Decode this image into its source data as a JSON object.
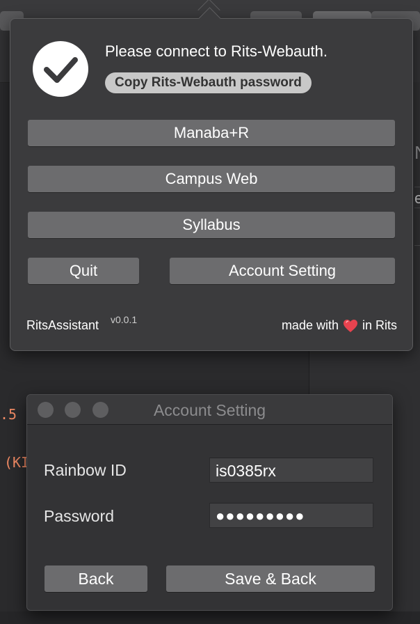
{
  "background": {
    "side_text_1": "N",
    "side_text_2": "e",
    "code_line_1": ".5",
    "code_line_2": "(KI"
  },
  "popover": {
    "status_title": "Please connect to Rits-Webauth.",
    "copy_button_label": "Copy Rits-Webauth password",
    "buttons": {
      "manaba": "Manaba+R",
      "campus_web": "Campus Web",
      "syllabus": "Syllabus",
      "quit": "Quit",
      "account_setting": "Account Setting"
    },
    "footer": {
      "app_name": "RitsAssistant",
      "version": "v0.0.1",
      "credit_prefix": "made with",
      "credit_suffix": "in Rits",
      "heart_icon": "heart-icon"
    }
  },
  "account_window": {
    "title": "Account Setting",
    "rainbow_id_label": "Rainbow ID",
    "rainbow_id_value": "is0385rx",
    "password_label": "Password",
    "password_value": "●●●●●●●●●",
    "back_label": "Back",
    "save_label": "Save & Back"
  },
  "colors": {
    "popover_bg": "#3b3b3d",
    "button_bg": "#6c6c6e",
    "heart": "#e8434f",
    "code_accent": "#f08a64"
  }
}
